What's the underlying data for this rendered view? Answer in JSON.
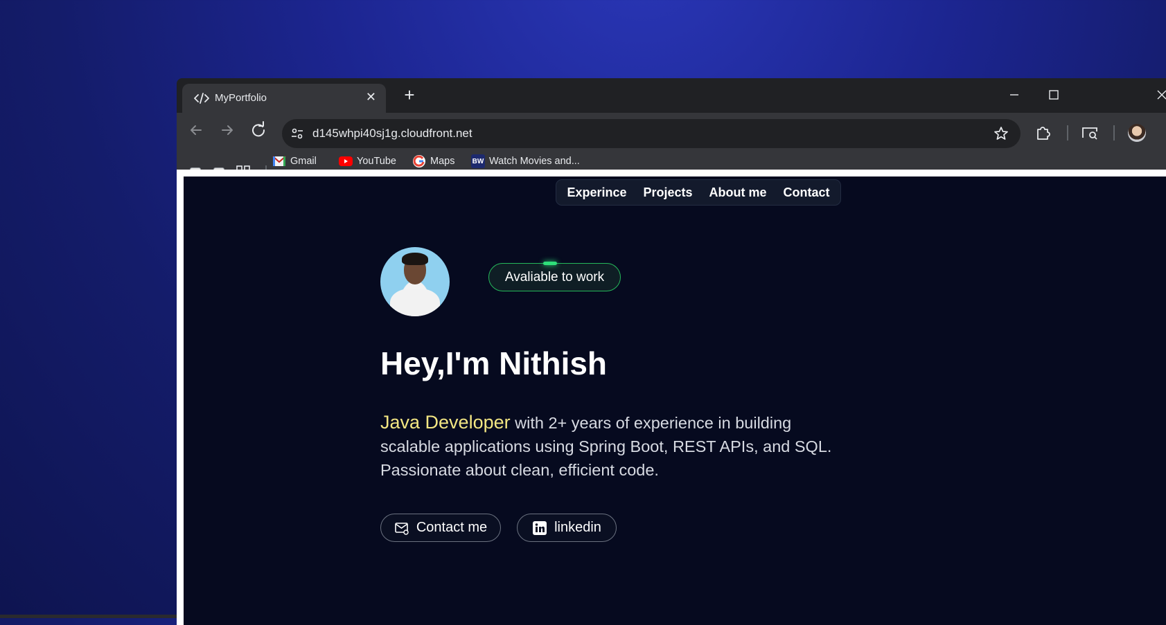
{
  "browser": {
    "tab_title": "MyPortfolio",
    "address": "d145whpi40sj1g.cloudfront.net",
    "bookmarks": [
      {
        "label": "Gmail",
        "icon": "gmail-icon"
      },
      {
        "label": "YouTube",
        "icon": "youtube-icon"
      },
      {
        "label": "Maps",
        "icon": "google-icon"
      },
      {
        "label": "Watch Movies and...",
        "icon": "bw-icon"
      }
    ],
    "bw_badge": "BW"
  },
  "nav": {
    "items": [
      "Experince",
      "Projects",
      "About me",
      "Contact"
    ]
  },
  "hero": {
    "status_badge": "Avaliable to work",
    "heading": "Hey,I'm Nithish",
    "role": "Java Developer",
    "intro_rest": " with 2+ years of experience in building scalable applications using Spring Boot, REST APIs, and SQL. Passionate about clean, efficient code.",
    "buttons": {
      "contact": "Contact me",
      "linkedin": "linkedin"
    }
  },
  "colors": {
    "page_bg": "#060a1f",
    "accent_yellow": "#f3e683",
    "badge_green": "#25b85a",
    "desktop_blue": "#1c2590",
    "chrome_dark": "#202124"
  }
}
